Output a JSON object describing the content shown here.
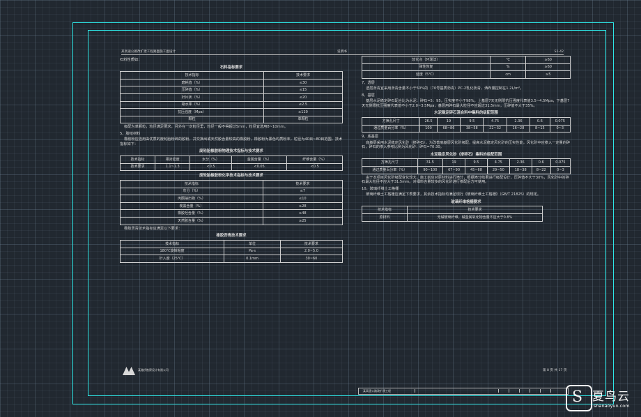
{
  "header": {
    "left": "某高速公路改扩建工程路面施工图设计",
    "center": "说明书",
    "right": "S1-42"
  },
  "left": {
    "intro": "石料性质如：",
    "stone_title": "石料指标要求",
    "stone_headers": [
      "技术指标",
      "技术要求"
    ],
    "stone_rows": [
      [
        "磨耗值（%）",
        "≤30"
      ],
      [
        "压碎值（%）",
        "≤15"
      ],
      [
        "针片状（%）",
        "≤20"
      ],
      [
        "吸水率（%）",
        "≤2.5"
      ],
      [
        "抗压强度（Mpa）",
        "≥120"
      ],
      [
        "颗粒",
        "单颗粒"
      ]
    ],
    "stone_note": "级配为单颗粒，粒径满足要求，另外在一定粒径里，粒径一般不得超过5mm，粒径宜选用8~10mm。",
    "sec5": "5、胶结材料",
    "sec5_para": "橡胶粉应选用由优质的废轮胎粉碎的胶粉，并交换出或天然胶含量较高的橡胶粉，橡胶粉为黑色均质粉末，粒径为40目~80目范围，技术指标如下：",
    "phys_title": "废轮胎橡胶粉物理技术指标与技术要求",
    "phys_headers": [
      "技术指标",
      "相对密度",
      "水分（%）",
      "金属含量（%）",
      "纤维含量（%）"
    ],
    "phys_row": [
      "技术要求",
      "1.1~1.3",
      "<0.5",
      "<0.05",
      "<0.5"
    ],
    "chem_title": "废轮胎橡胶粉化学技术指标与技术要求",
    "chem_headers": [
      "技术指标",
      "技术要求"
    ],
    "chem_rows": [
      [
        "灰分（%）",
        "≤7"
      ],
      [
        "丙酮抽出物（%）",
        "≤10"
      ],
      [
        "炭黑含量（%）",
        "≥28"
      ],
      [
        "橡胶烃含量（%）",
        "≥48"
      ],
      [
        "天然胶含量（%）",
        "≥25"
      ]
    ],
    "asphalt_intro": "橡胶沥青技术指标应满足以下要求：",
    "asphalt_title": "橡胶沥青技术要求",
    "asphalt_headers": [
      "技术指标",
      "单位",
      "技术要求"
    ],
    "asphalt_rows": [
      [
        "180℃旋转粘度",
        "Pa·s",
        "2.0~5.0"
      ],
      [
        "针入度（25℃）",
        "0.1mm",
        "30~60"
      ]
    ]
  },
  "right": {
    "top_rows": [
      [
        "软化点（环球法）",
        "℃",
        "≥60"
      ],
      [
        "弹性恢复",
        "%",
        "≥60"
      ],
      [
        "延度（5℃）",
        "cm",
        "≥5"
      ]
    ],
    "sec7": "7、透层",
    "sec7_para": "透层沥青宜采用沥青含量不小于50%的（70号基质沥青）PC-2乳化沥青，洒布量控制在1.2L/m²。",
    "sec8": "8、基层",
    "sec8_para": "基层水泥稳定碎石配合比为水泥：碎石=5：95，压实度不小于98%，上基层7天无侧限抗压强度代表值3.5~4.5Mpa，下基层7天无侧限抗压强度代表值不小于2.0~3.5Mpa，基层用碎石最大粒径不应超过31.5mm，压碎值不大于35%。",
    "base_title": "水泥稳定碎石混合料中集料的级配范围",
    "base_headers": [
      "方筛孔尺寸",
      "26.5",
      "19",
      "9.5",
      "4.75",
      "2.36",
      "0.6",
      "0.075"
    ],
    "base_row": [
      "通过质量百分率（%）",
      "100",
      "68~86",
      "38~58",
      "22~32",
      "16~28",
      "8~15",
      "0~3"
    ],
    "sec9": "9、底基层",
    "sec9_para": "底基层采用水泥稳定风化砂（掺碎石），为改善底基层风化砂级配，提高水泥稳定风化砂的压实性能，风化砂中应掺入一定量的碎石，碎石的掺入参考比例为风化砂：碎石=70:30。",
    "sub_title": "水泥稳定风化砂（掺碎石）集料的级配范围",
    "sub_headers": [
      "方筛孔尺寸",
      "31.5",
      "19",
      "9.5",
      "4.75",
      "2.36",
      "0.6",
      "0.075"
    ],
    "sub_row": [
      "通过质量百分率（%）",
      "90~100",
      "67~90",
      "45~68",
      "29~50",
      "18~38",
      "8~22",
      "0~3"
    ],
    "sub_para": "由于本项目风化砂级配变化较大，施工前应对原材料进行筛分，根据筛分结果进行级配设计，压碎值不大于30%，风化砂中的碎石最大粒径不应大于31.5mm。对细料含量较多的风化砂进行掺配后方可使用。",
    "sec10": "10、玻璃纤维土工格栅",
    "sec10_para": "玻璃纤维土工格栅应满足下表要求，其余技术指标均满足现行《玻璃纤维土工格栅》（GB/T 21825）的规定。",
    "grid_title": "玻璃纤维格栅要求",
    "grid_headers": [
      "技术指标",
      "技术要求"
    ],
    "grid_row": [
      "原材料",
      "无碱玻璃纤维，碱金属氧化物含量不应大于0.8%"
    ]
  },
  "footer": {
    "logo_text": "某路桥勘察设计有限公司",
    "page": "第 8 页  共 17 页",
    "titleblock": "某高速公路改扩建工程"
  },
  "watermark": {
    "name": "夏鸟云",
    "url": "shanaoyun.com"
  }
}
